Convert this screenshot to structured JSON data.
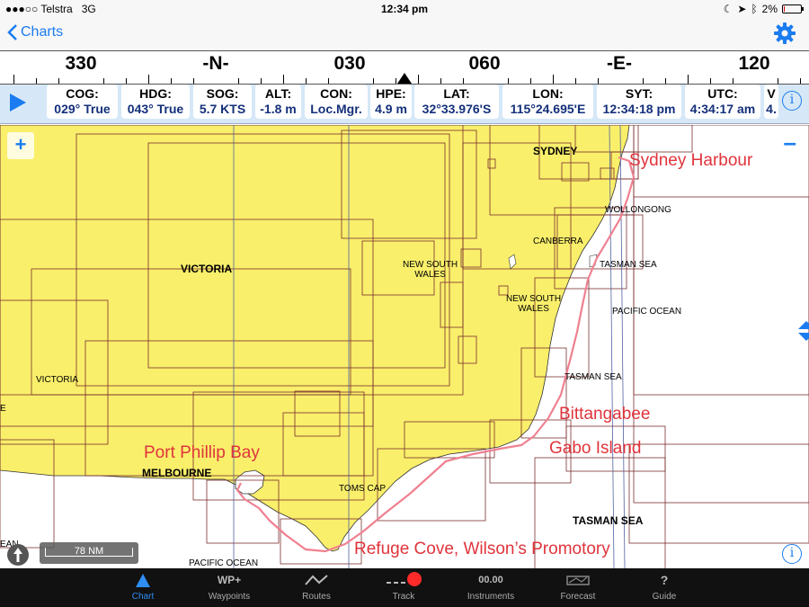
{
  "status_bar": {
    "carrier": "Telstra",
    "network": "3G",
    "time": "12:34 pm",
    "battery": "2%",
    "battery_level": 0.02
  },
  "nav": {
    "back_label": "Charts"
  },
  "compass": {
    "labels": [
      "330",
      "-N-",
      "030",
      "060",
      "-E-",
      "120"
    ]
  },
  "instruments": [
    {
      "label": "COG:",
      "value": "029° True"
    },
    {
      "label": "HDG:",
      "value": "043° True"
    },
    {
      "label": "SOG:",
      "value": "5.7 KTS"
    },
    {
      "label": "ALT:",
      "value": "-1.8 m"
    },
    {
      "label": "CON:",
      "value": "Loc.Mgr."
    },
    {
      "label": "HPE:",
      "value": "4.9 m"
    },
    {
      "label": "LAT:",
      "value": "32°33.976'S"
    },
    {
      "label": "LON:",
      "value": "115°24.695'E"
    },
    {
      "label": "SYT:",
      "value": "12:34:18 pm"
    },
    {
      "label": "UTC:",
      "value": "4:34:17 am"
    },
    {
      "label": "V",
      "value": "4."
    }
  ],
  "map": {
    "labels": {
      "sydney": "SYDNEY",
      "wollongong": "WOLLONGONG",
      "canberra": "CANBERRA",
      "tasman_sea_1": "TASMAN SEA",
      "pacific_ocean_1": "PACIFIC OCEAN",
      "tasman_sea_2": "TASMAN SEA",
      "tasman_sea_3": "TASMAN SEA",
      "victoria_1": "VICTORIA",
      "victoria_2": "VICTORIA",
      "nsw_1": "NEW SOUTH\nWALES",
      "nsw_2": "NEW SOUTH\nWALES",
      "melbourne": "MELBOURNE",
      "toms_cap": "TOMS CAP",
      "pacific_ocean_2": "PACIFIC OCEAN",
      "edge_left_1": "E",
      "edge_left_2": "EAN"
    },
    "annotations": {
      "sydney_harbour": "Sydney Harbour",
      "bittangabee": "Bittangabee",
      "gabo_island": "Gabo Island",
      "port_phillip_bay": "Port Phillip Bay",
      "refuge_cove": "Refuge Cove, Wilson’s Promotory"
    },
    "zoom_in": "+",
    "zoom_out": "–",
    "scale": "78 NM",
    "colors": {
      "land": "#f9ef6b",
      "route": "#f08090",
      "annotation": "#e0343c"
    }
  },
  "tabs": [
    {
      "id": "chart",
      "label": "Chart",
      "icon": "triangle-icon",
      "icon_text": ""
    },
    {
      "id": "waypoints",
      "label": "Waypoints",
      "icon": "wp-plus-icon",
      "icon_text": "WP+"
    },
    {
      "id": "routes",
      "label": "Routes",
      "icon": "route-zigzag-icon",
      "icon_text": ""
    },
    {
      "id": "track",
      "label": "Track",
      "icon": "track-record-icon",
      "icon_text": ""
    },
    {
      "id": "instruments",
      "label": "Instruments",
      "icon": "instruments-readout-icon",
      "icon_text": "00.00"
    },
    {
      "id": "forecast",
      "label": "Forecast",
      "icon": "forecast-icon",
      "icon_text": ""
    },
    {
      "id": "guide",
      "label": "Guide",
      "icon": "question-mark-icon",
      "icon_text": "?"
    }
  ]
}
